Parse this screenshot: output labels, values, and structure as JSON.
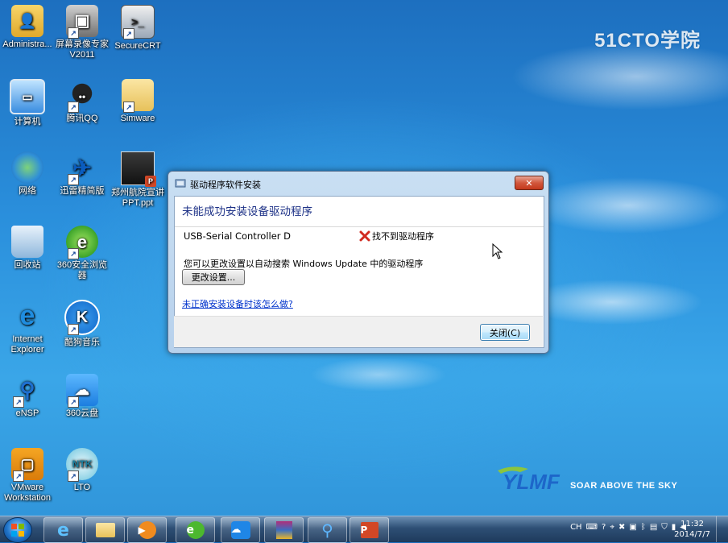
{
  "watermark": "51CTO学院",
  "brand": {
    "tagline": "SOAR ABOVE THE SKY"
  },
  "desktop_icons": [
    {
      "label": "Administra..."
    },
    {
      "label": "屏幕录像专家\nV2011"
    },
    {
      "label": "SecureCRT"
    },
    {
      "label": "计算机"
    },
    {
      "label": "腾讯QQ"
    },
    {
      "label": "Simware"
    },
    {
      "label": "网络"
    },
    {
      "label": "迅雷精简版"
    },
    {
      "label": "郑州航院宣讲\nPPT.ppt"
    },
    {
      "label": "回收站"
    },
    {
      "label": "360安全浏览\n器"
    },
    {
      "label": "Internet\nExplorer"
    },
    {
      "label": "酷狗音乐"
    },
    {
      "label": "eNSP"
    },
    {
      "label": "360云盘"
    },
    {
      "label": "VMware\nWorkstation"
    },
    {
      "label": "LTO"
    }
  ],
  "dialog": {
    "title": "驱动程序软件安装",
    "heading": "未能成功安装设备驱动程序",
    "device_name": "USB-Serial Controller D",
    "status_text": "找不到驱动程序",
    "hint": "您可以更改设置以自动搜索 Windows Update 中的驱动程序",
    "change_button": "更改设置...",
    "help_link": "未正确安装设备时该怎么做?",
    "close_button": "关闭(C)"
  },
  "taskbar": {
    "tray_lang": "CH",
    "clock_time": "11:32",
    "clock_date": "2014/7/7"
  }
}
